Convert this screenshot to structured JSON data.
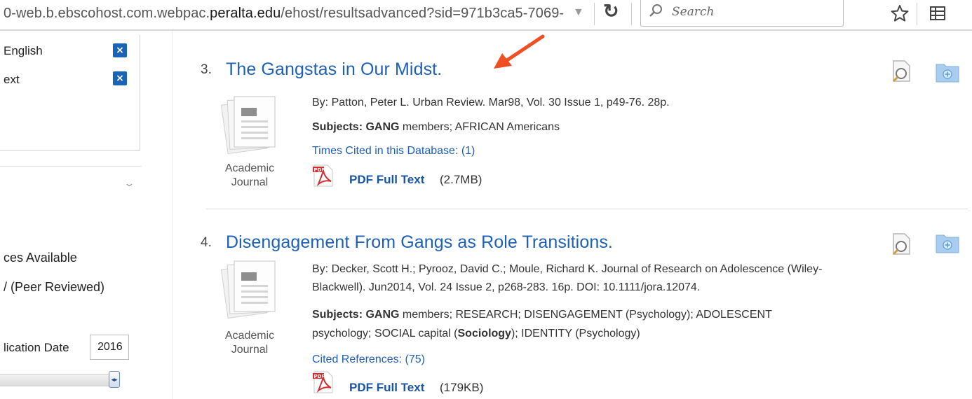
{
  "browser": {
    "url_prefix": "0-web.b.ebscohost.com.webpac.",
    "url_domain": "peralta.edu",
    "url_suffix": "/ehost/resultsadvanced?sid=971b3ca5-7069-",
    "dropdown_glyph": "▼",
    "search_placeholder": "Search"
  },
  "sidebar": {
    "applied_filters": [
      {
        "label": "English"
      },
      {
        "label": "ext"
      }
    ],
    "options": [
      {
        "label": "ces Available"
      },
      {
        "label": "/ (Peer Reviewed)"
      }
    ],
    "pub_date_label": "lication Date",
    "pub_date_value": "2016"
  },
  "results": [
    {
      "number": "3.",
      "title": "The Gangstas in Our Midst.",
      "byline": "By: Patton, Peter L. Urban Review. Mar98, Vol. 30 Issue 1, p49-76. 28p.",
      "subjects_label": "Subjects:",
      "subjects_line1_bold": "GANG",
      "subjects_line1_rest": " members; AFRICAN Americans",
      "extra_link": "Times Cited in this Database: (1)",
      "doc_type_line1": "Academic",
      "doc_type_line2": "Journal",
      "pdf_label": "PDF Full Text",
      "pdf_size": "(2.7MB)"
    },
    {
      "number": "4.",
      "title": "Disengagement From Gangs as Role Transitions.",
      "byline_line1": "By: Decker, Scott H.; Pyrooz, David C.; Moule, Richard K. Journal of Research on Adolescence (Wiley-",
      "byline_line2": "Blackwell). Jun2014, Vol. 24 Issue 2, p268-283. 16p. DOI: 10.1111/jora.12074.",
      "subjects_label": "Subjects:",
      "subjects_line1_bold": "GANG",
      "subjects_line1_rest": " members; RESEARCH; DISENGAGEMENT (Psychology); ADOLESCENT",
      "subjects_line2_pre": "psychology; SOCIAL capital (",
      "subjects_line2_bold": "Sociology",
      "subjects_line2_post": "); IDENTITY (Psychology)",
      "extra_link": "Cited References: (75)",
      "doc_type_line1": "Academic",
      "doc_type_line2": "Journal",
      "pdf_label": "PDF Full Text",
      "pdf_size": "(179KB)"
    }
  ],
  "colors": {
    "link": "#1d60b8",
    "filter_remove": "#1b63b5",
    "annotation_arrow": "#f04e23",
    "pdf_red": "#d32f2f"
  }
}
